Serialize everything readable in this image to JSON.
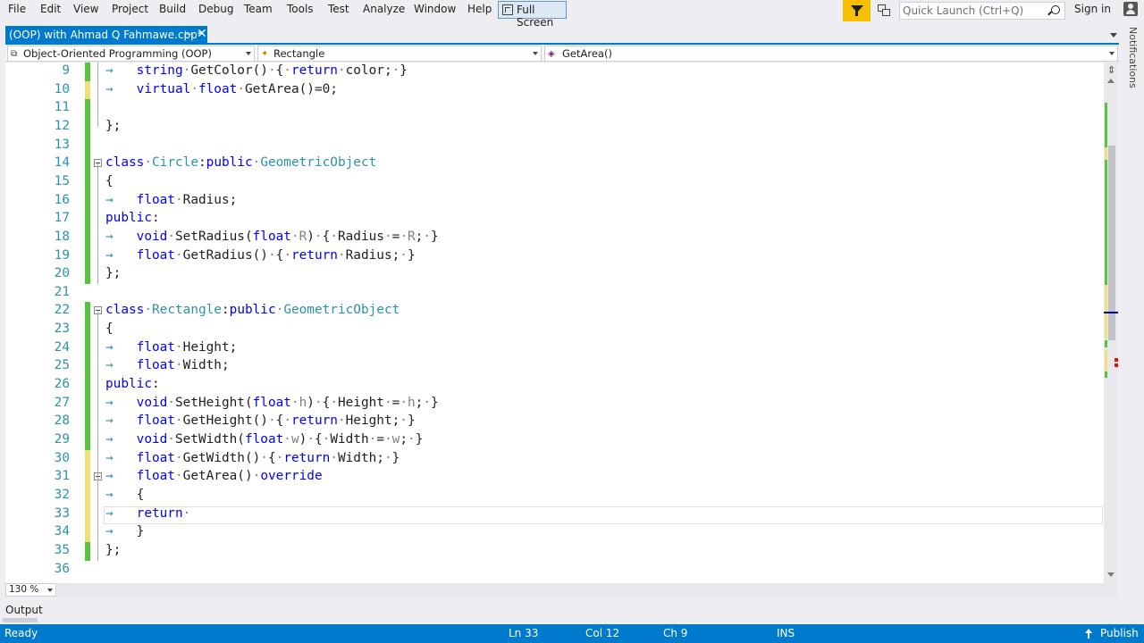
{
  "menu": {
    "items": [
      "File",
      "Edit",
      "View",
      "Project",
      "Build",
      "Debug",
      "Team",
      "Tools",
      "Test",
      "Analyze",
      "Window",
      "Help"
    ],
    "full_screen": "Full Screen",
    "quick_launch_placeholder": "Quick Launch (Ctrl+Q)",
    "sign_in": "Sign in"
  },
  "tab": {
    "label": "(OOP) with Ahmad Q Fahmawe.cpp*",
    "pin": "⊢",
    "close": "✕"
  },
  "notifications_label": "Notifications",
  "navbar": {
    "project": "Object-Oriented Programming (OOP)",
    "scope": "Rectangle",
    "member": "GetArea()"
  },
  "editor": {
    "current_line": 33,
    "lines": [
      {
        "n": "9",
        "change": "green"
      },
      {
        "n": "10",
        "change": "yellow"
      },
      {
        "n": "11",
        "change": "green"
      },
      {
        "n": "12",
        "change": "green"
      },
      {
        "n": "13",
        "change": "green"
      },
      {
        "n": "14",
        "change": "green"
      },
      {
        "n": "15",
        "change": "green"
      },
      {
        "n": "16",
        "change": "green"
      },
      {
        "n": "17",
        "change": "green"
      },
      {
        "n": "18",
        "change": "green"
      },
      {
        "n": "19",
        "change": "green"
      },
      {
        "n": "20",
        "change": "green"
      },
      {
        "n": "21",
        "change": "none"
      },
      {
        "n": "22",
        "change": "green"
      },
      {
        "n": "23",
        "change": "green"
      },
      {
        "n": "24",
        "change": "green"
      },
      {
        "n": "25",
        "change": "green"
      },
      {
        "n": "26",
        "change": "green"
      },
      {
        "n": "27",
        "change": "green"
      },
      {
        "n": "28",
        "change": "green"
      },
      {
        "n": "29",
        "change": "green"
      },
      {
        "n": "30",
        "change": "yellow"
      },
      {
        "n": "31",
        "change": "yellow"
      },
      {
        "n": "32",
        "change": "yellow"
      },
      {
        "n": "33",
        "change": "yellow"
      },
      {
        "n": "34",
        "change": "yellow"
      },
      {
        "n": "35",
        "change": "green"
      },
      {
        "n": "36",
        "change": "none"
      }
    ]
  },
  "zoom": "130 %",
  "output_tab": "Output",
  "status": {
    "state": "Ready",
    "ln": "Ln 33",
    "col": "Col 12",
    "ch": "Ch 9",
    "mode": "INS",
    "publish": "Publish"
  },
  "colors": {
    "accent": "#007acc",
    "change_green": "#57c33c",
    "change_yellow": "#efe17a",
    "keyword": "#0000ff",
    "type_name": "#2b91af",
    "filter_button": "#f6c000"
  }
}
